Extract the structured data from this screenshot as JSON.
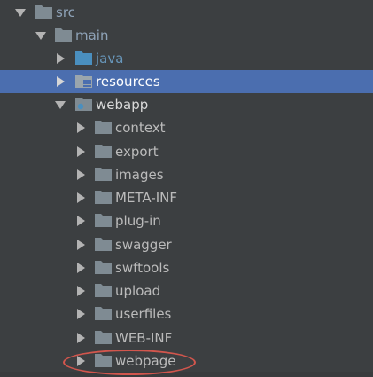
{
  "colors": {
    "background": "#3c3f41",
    "selection": "#4b6eaf",
    "folder_grey": "#7f8b93",
    "folder_java": "#4a8fbf",
    "highlight": "#d2564d"
  },
  "tree": {
    "items": [
      {
        "label": "src",
        "expanded": true,
        "icon": "folder-icon"
      },
      {
        "label": "main",
        "expanded": true,
        "icon": "folder-icon"
      },
      {
        "label": "java",
        "expanded": false,
        "icon": "source-folder-icon"
      },
      {
        "label": "resources",
        "expanded": false,
        "selected": true,
        "icon": "resources-folder-icon"
      },
      {
        "label": "webapp",
        "expanded": true,
        "icon": "web-folder-icon"
      },
      {
        "label": "context",
        "expanded": false,
        "icon": "folder-icon"
      },
      {
        "label": "export",
        "expanded": false,
        "icon": "folder-icon"
      },
      {
        "label": "images",
        "expanded": false,
        "icon": "folder-icon"
      },
      {
        "label": "META-INF",
        "expanded": false,
        "icon": "folder-icon"
      },
      {
        "label": "plug-in",
        "expanded": false,
        "icon": "folder-icon"
      },
      {
        "label": "swagger",
        "expanded": false,
        "icon": "folder-icon"
      },
      {
        "label": "swftools",
        "expanded": false,
        "icon": "folder-icon"
      },
      {
        "label": "upload",
        "expanded": false,
        "icon": "folder-icon"
      },
      {
        "label": "userfiles",
        "expanded": false,
        "icon": "folder-icon"
      },
      {
        "label": "WEB-INF",
        "expanded": false,
        "icon": "folder-icon"
      },
      {
        "label": "webpage",
        "expanded": false,
        "highlighted": true,
        "icon": "folder-icon"
      }
    ]
  }
}
